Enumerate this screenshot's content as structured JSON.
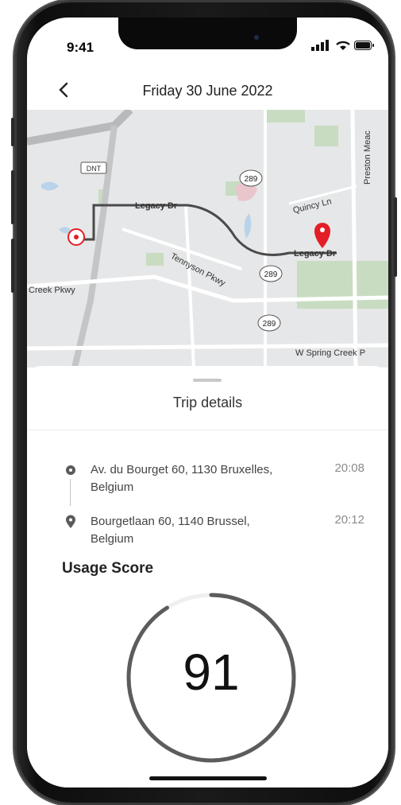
{
  "status_bar": {
    "time": "9:41"
  },
  "header": {
    "title": "Friday 30 June 2022",
    "back_icon": "chevron-left-icon"
  },
  "map": {
    "labels": {
      "dnt": "DNT",
      "legacy_dr_1": "Legacy Dr",
      "legacy_dr_2": "Legacy Dr",
      "quincy_ln": "Quincy Ln",
      "preston": "Preston Meac",
      "tennyson": "Tennyson Pkwy",
      "creek_pkwy": "Creek Pkwy",
      "w_spring": "W Spring Creek P",
      "hwy_a": "289",
      "hwy_b": "289",
      "hwy_c": "289"
    },
    "colors": {
      "route": "#4a4a4a",
      "pin": "#e41e26",
      "start_ring": "#e41e26",
      "park": "#c8dcc1",
      "water": "#b9d3ea"
    }
  },
  "trip": {
    "title": "Trip details",
    "stops": [
      {
        "address_line1": "Av. du Bourget 60, 1130 Bruxelles,",
        "address_line2": "Belgium",
        "time": "20:08",
        "icon": "dot-icon"
      },
      {
        "address_line1": "Bourgetlaan 60, 1140 Brussel,",
        "address_line2": "Belgium",
        "time": "20:12",
        "icon": "location-pin-icon"
      }
    ]
  },
  "usage_score": {
    "title": "Usage Score",
    "value": "91",
    "fraction": 0.91,
    "colors": {
      "arc": "#5c5c5c",
      "track": "#efefef"
    }
  }
}
